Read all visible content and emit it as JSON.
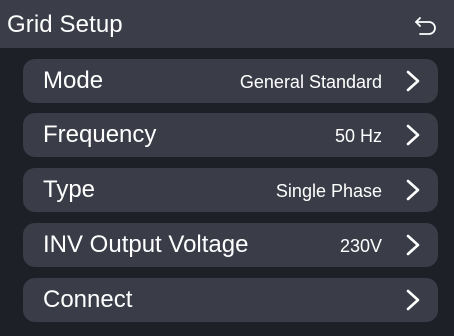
{
  "header": {
    "title": "Grid Setup",
    "back_icon": "back-arrow-icon"
  },
  "rows": [
    {
      "label": "Mode",
      "value": "General Standard"
    },
    {
      "label": "Frequency",
      "value": "50 Hz"
    },
    {
      "label": "Type",
      "value": "Single Phase"
    },
    {
      "label": "INV Output Voltage",
      "value": "230V"
    },
    {
      "label": "Connect",
      "value": ""
    }
  ],
  "colors": {
    "background": "#1e2027",
    "header": "#3b3e49",
    "row": "#3a3d48",
    "text": "#ffffff"
  }
}
